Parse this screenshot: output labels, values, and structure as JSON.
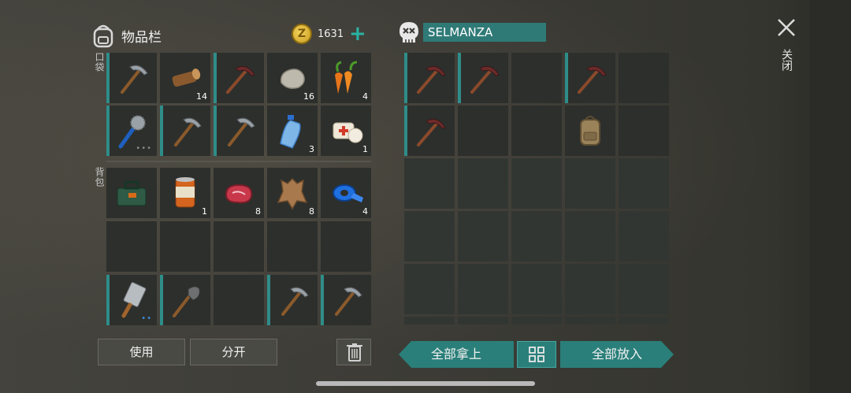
{
  "header": {
    "title": "物品栏",
    "coins": "1631",
    "coin_symbol": "Z"
  },
  "sections": {
    "pocket": "口袋",
    "backpack": "背包"
  },
  "pocket_slots": [
    {
      "item": "pickaxe",
      "count": ""
    },
    {
      "item": "log",
      "count": "14"
    },
    {
      "item": "pickaxe",
      "count": ""
    },
    {
      "item": "stone",
      "count": "16"
    },
    {
      "item": "carrot",
      "count": "4"
    },
    {
      "item": "spiked-club",
      "count": ""
    },
    {
      "item": "pickaxe",
      "count": ""
    },
    {
      "item": "pickaxe",
      "count": ""
    },
    {
      "item": "water-bottle",
      "count": "3"
    },
    {
      "item": "bandage",
      "count": "1"
    }
  ],
  "backpack_slots": [
    {
      "item": "toolbox",
      "count": ""
    },
    {
      "item": "canned-food",
      "count": "1"
    },
    {
      "item": "raw-meat",
      "count": "8"
    },
    {
      "item": "leather",
      "count": "8"
    },
    {
      "item": "duct-tape",
      "count": "4"
    }
  ],
  "quick_slots": [
    {
      "item": "cleaver",
      "count": ""
    },
    {
      "item": "shovel",
      "count": ""
    },
    {
      "item": "empty",
      "count": ""
    },
    {
      "item": "pickaxe",
      "count": ""
    },
    {
      "item": "pickaxe",
      "count": ""
    }
  ],
  "buttons": {
    "use": "使用",
    "split": "分开",
    "take_all": "全部拿上",
    "put_all": "全部放入"
  },
  "loot": {
    "name": "SELMANZA"
  },
  "loot_slots": [
    "pickaxe",
    "pickaxe",
    "empty",
    "pickaxe",
    "empty",
    "pickaxe",
    "empty",
    "empty",
    "backpack",
    "empty"
  ],
  "close": {
    "label": "关闭"
  },
  "colors": {
    "accent": "#2a7f7a",
    "slot_bar": "#2e8d89",
    "slot_bg": "#2d2f2c"
  }
}
